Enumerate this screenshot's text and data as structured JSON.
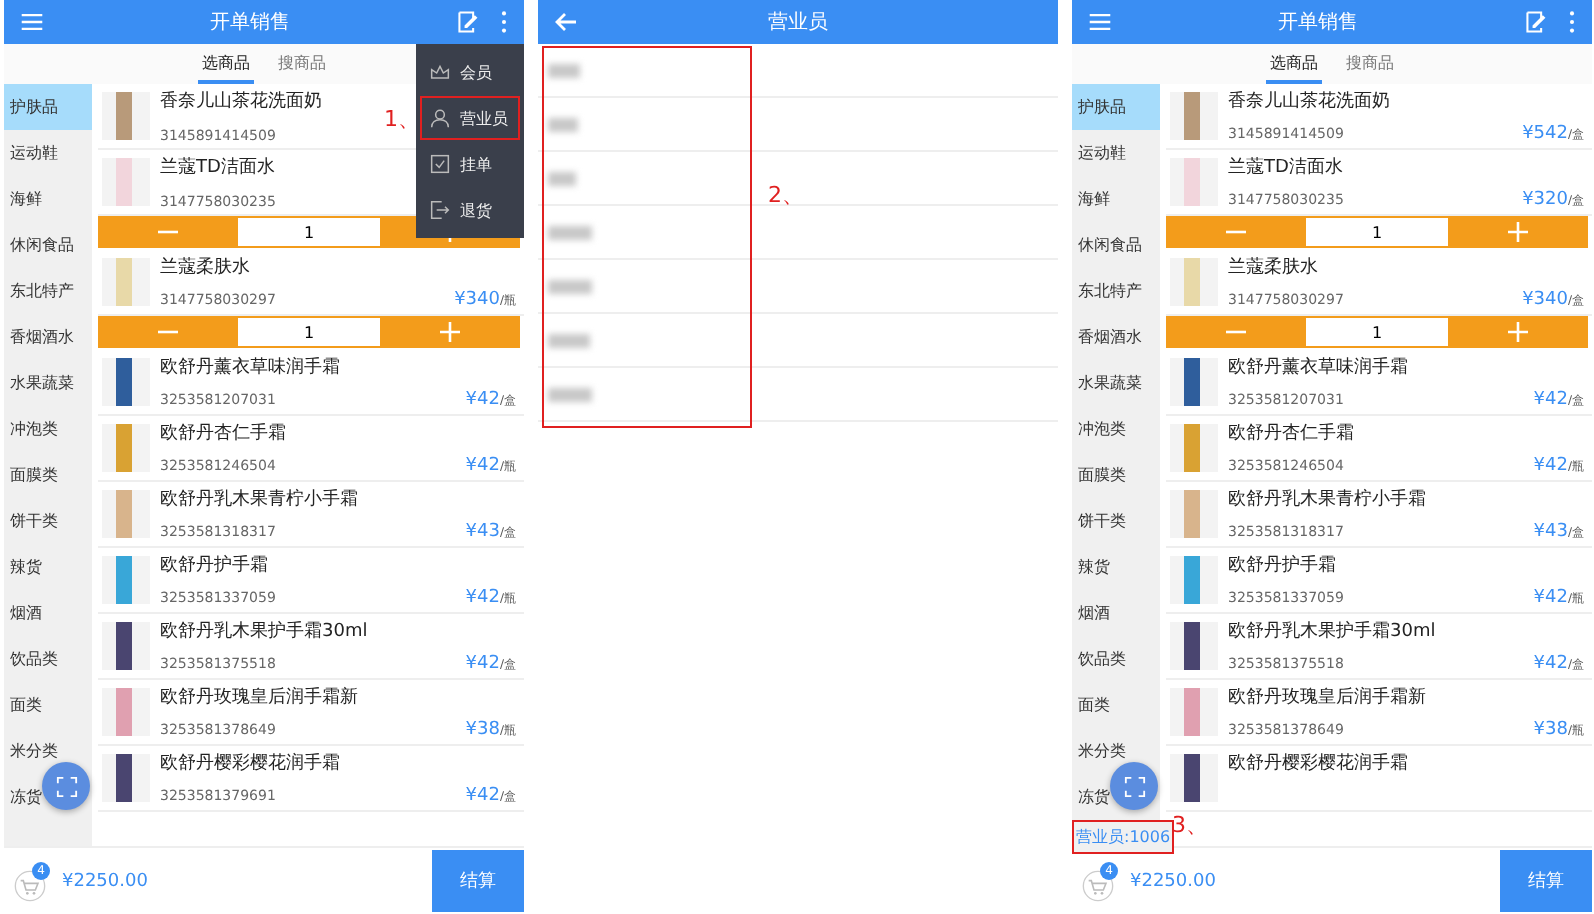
{
  "screens": [
    {
      "kind": "sales",
      "title": "开单销售",
      "callout": "1、",
      "tabs": [
        {
          "label": "选商品",
          "selected": true
        },
        {
          "label": "搜商品",
          "selected": false
        }
      ],
      "categories": [
        {
          "label": "护肤品",
          "selected": true
        },
        {
          "label": "运动鞋",
          "selected": false
        },
        {
          "label": "海鲜",
          "selected": false
        },
        {
          "label": "休闲食品",
          "selected": false
        },
        {
          "label": "东北特产",
          "selected": false
        },
        {
          "label": "香烟酒水",
          "selected": false
        },
        {
          "label": "水果蔬菜",
          "selected": false
        },
        {
          "label": "冲泡类",
          "selected": false
        },
        {
          "label": "面膜类",
          "selected": false
        },
        {
          "label": "饼干类",
          "selected": false
        },
        {
          "label": "辣货",
          "selected": false
        },
        {
          "label": "烟酒",
          "selected": false
        },
        {
          "label": "饮品类",
          "selected": false
        },
        {
          "label": "面类",
          "selected": false
        },
        {
          "label": "米分类",
          "selected": false
        },
        {
          "label": "冻货",
          "selected": false
        }
      ],
      "products": [
        {
          "name": "香奈儿山茶花洗面奶",
          "code": "3145891414509"
        },
        {
          "name": "兰蔻TD洁面水",
          "code": "3147758030235",
          "quantity": "1"
        },
        {
          "name": "兰蔻柔肤水",
          "code": "3147758030297",
          "price": "¥340",
          "unit": "/瓶",
          "quantity": "1"
        },
        {
          "name": "欧舒丹薰衣草味润手霜",
          "code": "3253581207031",
          "price": "¥42",
          "unit": "/盒"
        },
        {
          "name": "欧舒丹杏仁手霜",
          "code": "3253581246504",
          "price": "¥42",
          "unit": "/瓶"
        },
        {
          "name": "欧舒丹乳木果青柠小手霜",
          "code": "3253581318317",
          "price": "¥43",
          "unit": "/盒"
        },
        {
          "name": "欧舒丹护手霜",
          "code": "3253581337059",
          "price": "¥42",
          "unit": "/瓶"
        },
        {
          "name": "欧舒丹乳木果护手霜30ml",
          "code": "3253581375518",
          "price": "¥42",
          "unit": "/盒"
        },
        {
          "name": "欧舒丹玫瑰皇后润手霜新",
          "code": "3253581378649",
          "price": "¥38",
          "unit": "/瓶"
        },
        {
          "name": "欧舒丹樱彩樱花润手霜",
          "code": "3253581379691",
          "price": "¥42",
          "unit": "/盒"
        }
      ],
      "menu": [
        {
          "label": "会员",
          "highlighted": false
        },
        {
          "label": "营业员",
          "highlighted": true
        },
        {
          "label": "挂单",
          "highlighted": false
        },
        {
          "label": "退货",
          "highlighted": false
        }
      ],
      "cart": {
        "count": "4",
        "total": "¥2250.00"
      },
      "checkout": "结算"
    },
    {
      "kind": "staff_list",
      "title": "营业员",
      "callout": "2、",
      "highlighted": true,
      "staff": [
        {
          "redacted": true
        },
        {
          "redacted": true
        },
        {
          "redacted": true
        },
        {
          "redacted": true
        },
        {
          "redacted": true
        },
        {
          "redacted": true
        },
        {
          "redacted": true
        }
      ]
    },
    {
      "kind": "sales",
      "title": "开单销售",
      "callout": "3、",
      "tabs": [
        {
          "label": "选商品",
          "selected": true
        },
        {
          "label": "搜商品",
          "selected": false
        }
      ],
      "categories": [
        {
          "label": "护肤品",
          "selected": true
        },
        {
          "label": "运动鞋",
          "selected": false
        },
        {
          "label": "海鲜",
          "selected": false
        },
        {
          "label": "休闲食品",
          "selected": false
        },
        {
          "label": "东北特产",
          "selected": false
        },
        {
          "label": "香烟酒水",
          "selected": false
        },
        {
          "label": "水果蔬菜",
          "selected": false
        },
        {
          "label": "冲泡类",
          "selected": false
        },
        {
          "label": "面膜类",
          "selected": false
        },
        {
          "label": "饼干类",
          "selected": false
        },
        {
          "label": "辣货",
          "selected": false
        },
        {
          "label": "烟酒",
          "selected": false
        },
        {
          "label": "饮品类",
          "selected": false
        },
        {
          "label": "面类",
          "selected": false
        },
        {
          "label": "米分类",
          "selected": false
        },
        {
          "label": "冻货",
          "selected": false
        }
      ],
      "products": [
        {
          "name": "香奈儿山茶花洗面奶",
          "code": "3145891414509",
          "price": "¥542",
          "unit": "/盒"
        },
        {
          "name": "兰蔻TD洁面水",
          "code": "3147758030235",
          "price": "¥320",
          "unit": "/盒",
          "quantity": "1"
        },
        {
          "name": "兰蔻柔肤水",
          "code": "3147758030297",
          "price": "¥340",
          "unit": "/盒",
          "quantity": "1"
        },
        {
          "name": "欧舒丹薰衣草味润手霜",
          "code": "3253581207031",
          "price": "¥42",
          "unit": "/盒"
        },
        {
          "name": "欧舒丹杏仁手霜",
          "code": "3253581246504",
          "price": "¥42",
          "unit": "/瓶"
        },
        {
          "name": "欧舒丹乳木果青柠小手霜",
          "code": "3253581318317",
          "price": "¥43",
          "unit": "/盒"
        },
        {
          "name": "欧舒丹护手霜",
          "code": "3253581337059",
          "price": "¥42",
          "unit": "/瓶"
        },
        {
          "name": "欧舒丹乳木果护手霜30ml",
          "code": "3253581375518",
          "price": "¥42",
          "unit": "/盒"
        },
        {
          "name": "欧舒丹玫瑰皇后润手霜新",
          "code": "3253581378649",
          "price": "¥38",
          "unit": "/瓶"
        },
        {
          "name": "欧舒丹樱彩樱花润手霜"
        }
      ],
      "staff_label": {
        "text": "营业员:1006",
        "highlighted": true
      },
      "cart": {
        "count": "4",
        "total": "¥2250.00"
      },
      "checkout": "结算"
    }
  ]
}
